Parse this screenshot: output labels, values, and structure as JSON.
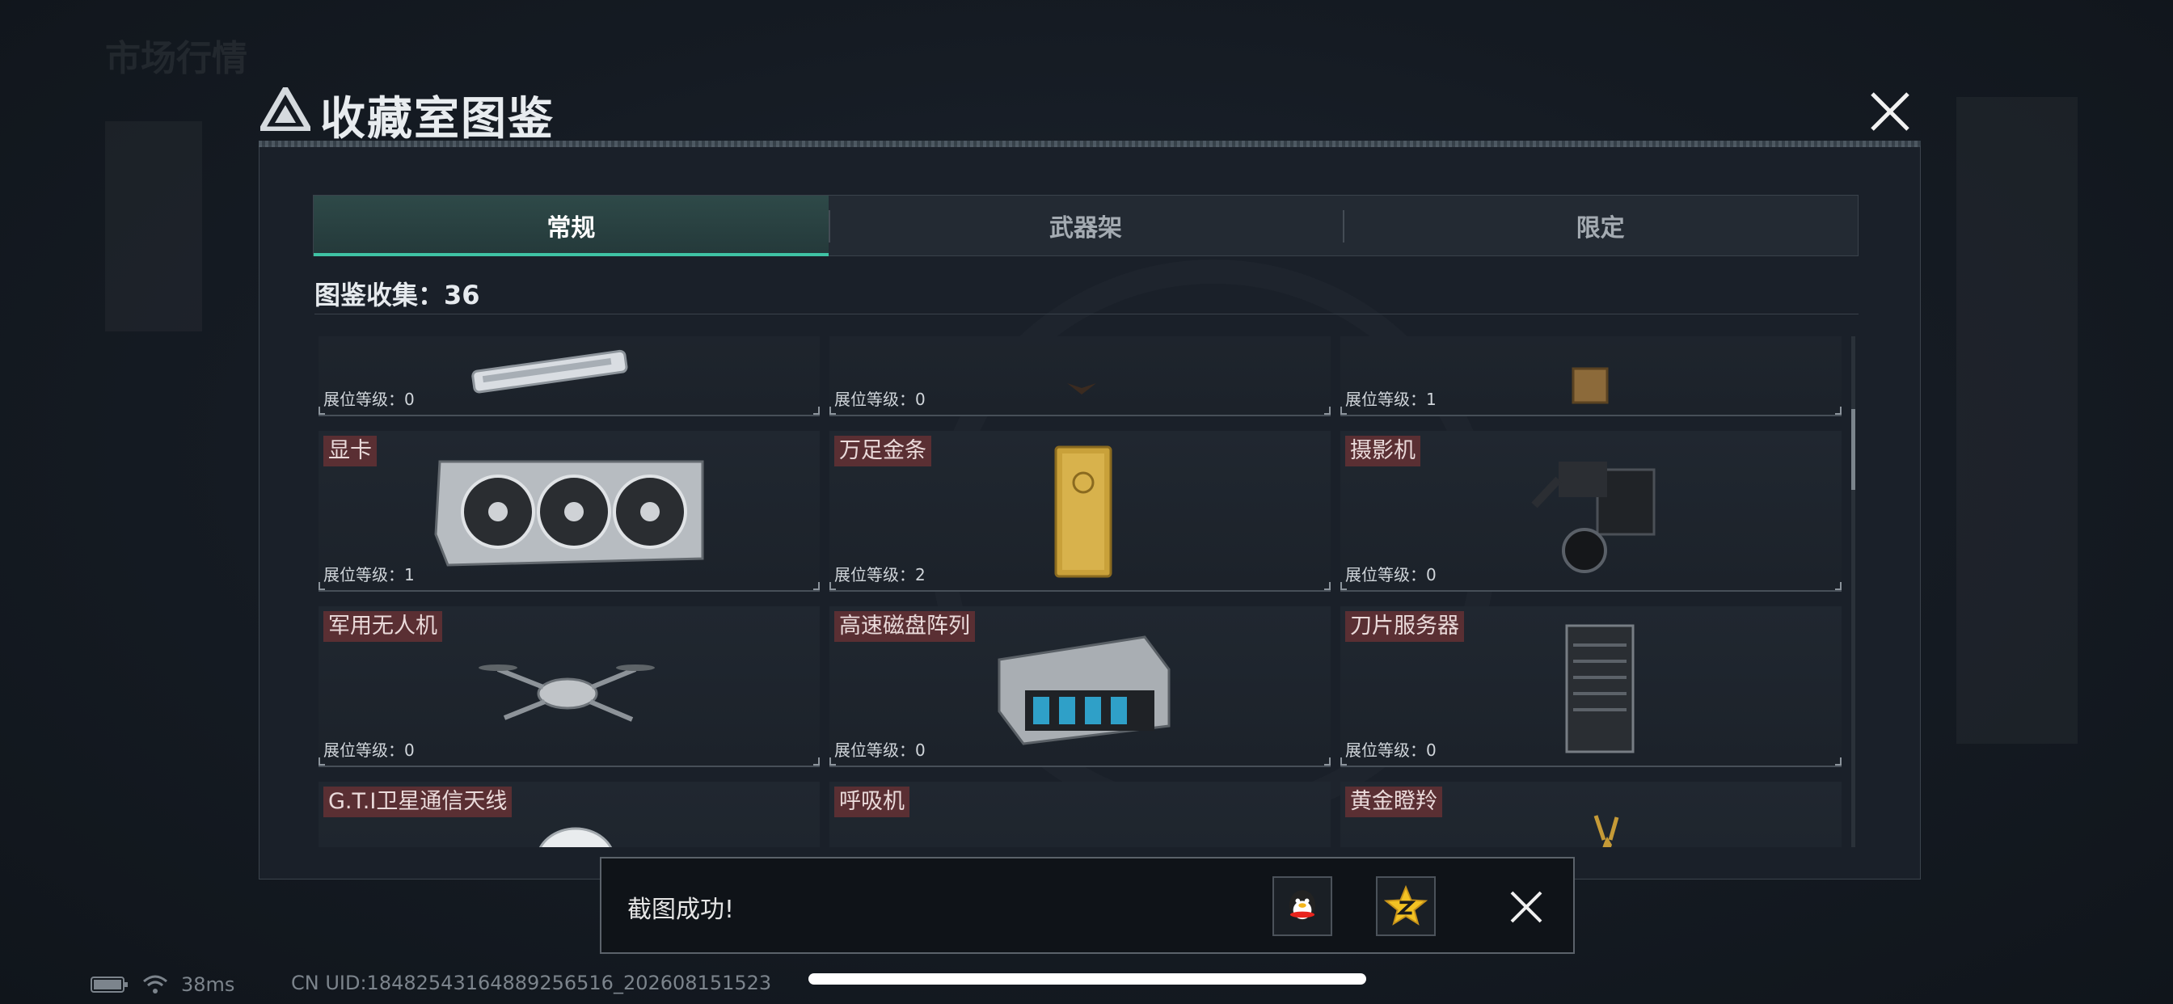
{
  "background": {
    "title": "市场行情"
  },
  "modal": {
    "title": "收藏室图鉴"
  },
  "tabs": [
    {
      "label": "常规",
      "active": true
    },
    {
      "label": "武器架",
      "active": false
    },
    {
      "label": "限定",
      "active": false
    }
  ],
  "collection": {
    "label": "图鉴收集：36"
  },
  "items": [
    {
      "name": "",
      "level_label": "展位等级：0",
      "icon": "keyboard-icon"
    },
    {
      "name": "",
      "level_label": "展位等级：0",
      "icon": "bird-statue-icon"
    },
    {
      "name": "",
      "level_label": "展位等级：1",
      "icon": "box-icon"
    },
    {
      "name": "显卡",
      "level_label": "展位等级：1",
      "icon": "graphics-card-icon"
    },
    {
      "name": "万足金条",
      "level_label": "展位等级：2",
      "icon": "gold-bar-icon"
    },
    {
      "name": "摄影机",
      "level_label": "展位等级：0",
      "icon": "video-camera-icon"
    },
    {
      "name": "军用无人机",
      "level_label": "展位等级：0",
      "icon": "drone-icon"
    },
    {
      "name": "高速磁盘阵列",
      "level_label": "展位等级：0",
      "icon": "disk-array-icon"
    },
    {
      "name": "刀片服务器",
      "level_label": "展位等级：0",
      "icon": "blade-server-icon"
    },
    {
      "name": "G.T.I卫星通信天线",
      "level_label": "",
      "icon": "satellite-dish-icon"
    },
    {
      "name": "呼吸机",
      "level_label": "",
      "icon": "ventilator-icon"
    },
    {
      "name": "黄金瞪羚",
      "level_label": "",
      "icon": "golden-gazelle-icon"
    }
  ],
  "toast": {
    "message": "截图成功!",
    "share_icons": [
      "qq-icon",
      "qzone-icon"
    ]
  },
  "status_bar": {
    "ping": "38ms",
    "uid": "CN UID:18482543164889256516_202608151523"
  },
  "colors": {
    "accent": "#3fc3a4",
    "name_tag": "#5a2f33",
    "gold": "#c9a13a"
  }
}
